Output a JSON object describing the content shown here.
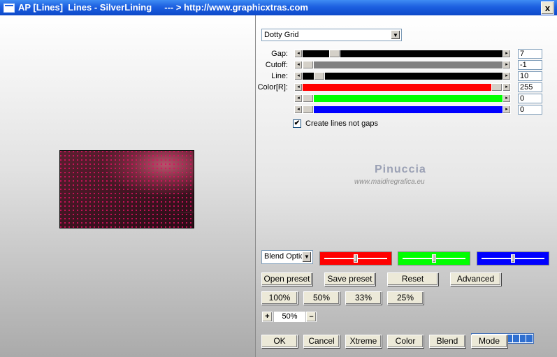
{
  "window": {
    "title": "AP [Lines]  Lines - SilverLining     --- > http://www.graphicxtras.com",
    "close_label": "x"
  },
  "preset_combo": {
    "value": "Dotty Grid"
  },
  "sliders": [
    {
      "label": "Gap:",
      "value": "7",
      "fraction": 0.14,
      "color": "#000000"
    },
    {
      "label": "Cutoff:",
      "value": "-1",
      "fraction": 0.0,
      "color": "#808080"
    },
    {
      "label": "Line:",
      "value": "10",
      "fraction": 0.06,
      "color": "#000000"
    },
    {
      "label": "Color[R]:",
      "value": "255",
      "fraction": 1.0,
      "color": "#ff0000"
    },
    {
      "label": "",
      "value": "0",
      "fraction": 0.0,
      "color": "#00ff00"
    },
    {
      "label": "",
      "value": "0",
      "fraction": 0.0,
      "color": "#0000ff"
    }
  ],
  "checkbox": {
    "label": "Create lines not gaps",
    "checked": true,
    "mark": "✔"
  },
  "watermark": {
    "line1": "Pinuccia",
    "line2": "www.maidiregrafica.eu"
  },
  "blend_combo": {
    "value": "Blend Optic"
  },
  "mini_sliders": [
    {
      "color": "#ff0000",
      "level": 0.5
    },
    {
      "color": "#00ff00",
      "level": 0.5
    },
    {
      "color": "#0000ff",
      "level": 0.5
    }
  ],
  "buttons_row1": [
    "Open preset",
    "Save preset",
    "Reset",
    "Advanced"
  ],
  "zoom_buttons": [
    "100%",
    "50%",
    "33%",
    "25%"
  ],
  "zoom": {
    "plus": "+",
    "value": "50%",
    "minus": "–"
  },
  "progress": {
    "segments": 9
  },
  "bottom_buttons": [
    "OK",
    "Cancel",
    "Xtreme",
    "Color",
    "Blend",
    "Mode"
  ]
}
